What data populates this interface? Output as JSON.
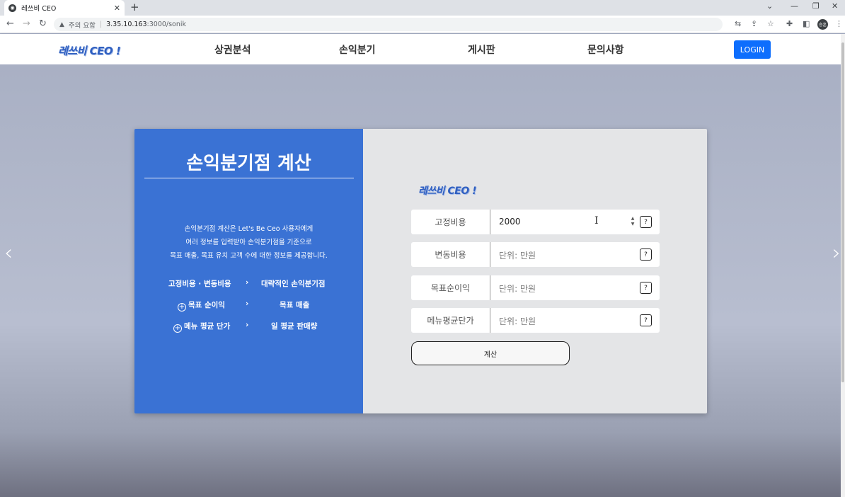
{
  "browser": {
    "tab_title": "레쓰비 CEO",
    "tab_close": "✕",
    "new_tab": "+",
    "security_label": "주의 요함",
    "url_host": "3.35.10.163",
    "url_path": ":3000/sonik",
    "profile_initials": "승훈"
  },
  "header": {
    "logo": "레쓰비 CEO !",
    "menu": [
      "상권분석",
      "손익분기",
      "게시판",
      "문의사항"
    ],
    "login": "LOGIN"
  },
  "left": {
    "title": "손익분기점 계산",
    "desc": [
      "손익분기점 계산은 Let's Be Ceo 사용자에게",
      "여러 정보를 입력받아 손익분기점을 기준으로",
      "목표 매출, 목표 유치 고객 수에 대한 정보를 제공합니다."
    ],
    "rows": [
      {
        "from": "고정비용 · 변동비용",
        "to": "대략적인 손익분기점",
        "plus": false
      },
      {
        "from": "목표 순이익",
        "to": "목표 매출",
        "plus": true
      },
      {
        "from": "메뉴 평균 단가",
        "to": "일 평균 판매량",
        "plus": true
      }
    ]
  },
  "right": {
    "logo": "레쓰비 CEO !",
    "fields": [
      {
        "label": "고정비용",
        "value": "2000",
        "placeholder": ""
      },
      {
        "label": "변동비용",
        "value": "",
        "placeholder": "단위: 만원"
      },
      {
        "label": "목표순이익",
        "value": "",
        "placeholder": "단위: 만원"
      },
      {
        "label": "메뉴평균단가",
        "value": "",
        "placeholder": "단위: 만원"
      }
    ],
    "help": "?",
    "calc": "계산"
  }
}
